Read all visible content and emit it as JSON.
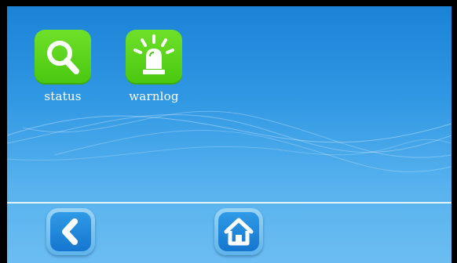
{
  "apps": [
    {
      "label": "status",
      "icon": "magnifier-icon"
    },
    {
      "label": "warnlog",
      "icon": "alarm-beacon-icon"
    }
  ],
  "nav": {
    "back_icon": "chevron-left-icon",
    "home_icon": "home-icon"
  },
  "colors": {
    "tile_green": "#4cc713",
    "sky_top": "#1a83d6",
    "sky_bottom": "#6bbdf1",
    "button_blue": "#1d80d6"
  }
}
